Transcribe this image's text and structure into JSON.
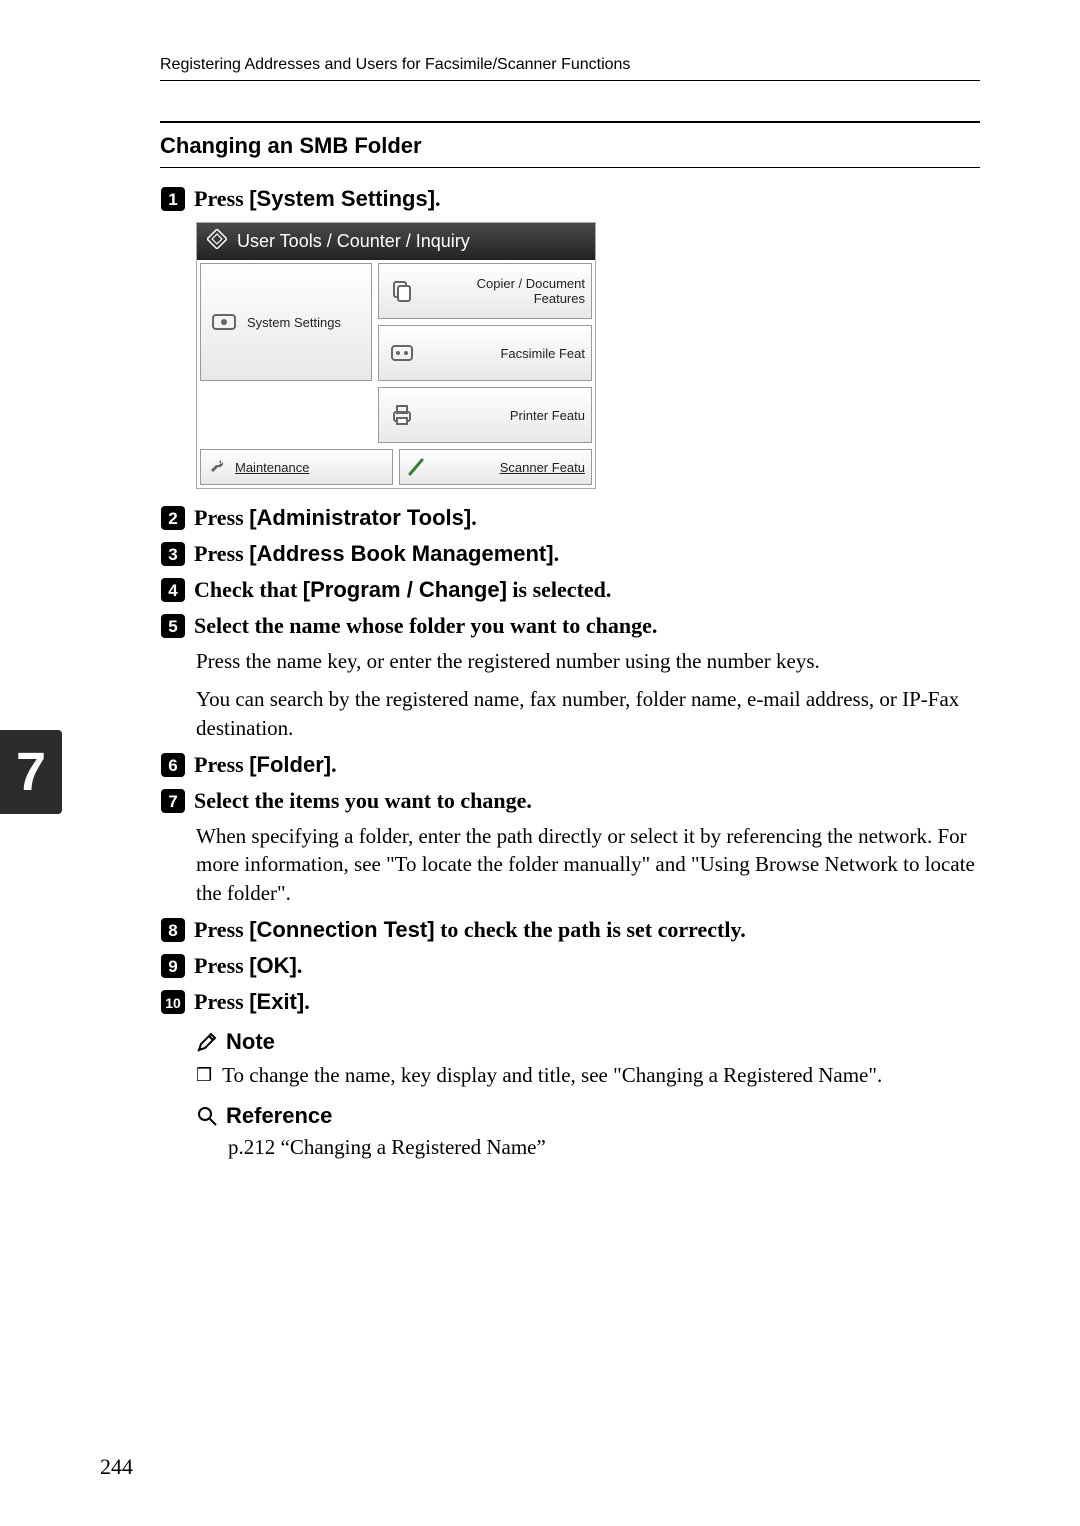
{
  "running_head": "Registering Addresses and Users for Facsimile/Scanner Functions",
  "section_heading": "Changing an SMB Folder",
  "side_tab": "7",
  "page_number": "244",
  "steps": [
    {
      "n": "1",
      "prefix": "Press ",
      "ui": "[System Settings]",
      "suffix": "."
    },
    {
      "n": "2",
      "prefix": "Press ",
      "ui": "[Administrator Tools]",
      "suffix": "."
    },
    {
      "n": "3",
      "prefix": "Press ",
      "ui": "[Address Book Management]",
      "suffix": "."
    },
    {
      "n": "4",
      "prefix": "Check that ",
      "ui": "[Program / Change]",
      "suffix": " is selected."
    },
    {
      "n": "5",
      "prefix": "Select the name whose folder you want to change.",
      "ui": "",
      "suffix": ""
    },
    {
      "n": "6",
      "prefix": "Press ",
      "ui": "[Folder]",
      "suffix": "."
    },
    {
      "n": "7",
      "prefix": "Select the items you want to change.",
      "ui": "",
      "suffix": ""
    },
    {
      "n": "8",
      "prefix": "Press ",
      "ui": "[Connection Test]",
      "suffix": " to check the path is set correctly."
    },
    {
      "n": "9",
      "prefix": "Press ",
      "ui": "[OK]",
      "suffix": "."
    },
    {
      "n": "10",
      "prefix": "Press ",
      "ui": "[Exit]",
      "suffix": "."
    }
  ],
  "step5_body": [
    "Press the name key, or enter the registered number using the number keys.",
    "You can search by the registered name, fax number, folder name, e-mail address, or IP-Fax destination."
  ],
  "step7_body": "When specifying a folder, enter the path directly or select it by referencing the network. For more information, see \"To locate the folder manually\" and \"Using Browse Network to locate the folder\".",
  "note": {
    "heading": "Note",
    "bullet": "To change the name, key display and title, see \"Changing a Registered Name\"."
  },
  "reference": {
    "heading": "Reference",
    "body": "p.212 “Changing a Registered Name”"
  },
  "ui_shot": {
    "title": "User Tools / Counter / Inquiry",
    "system_settings": "System Settings",
    "copier": "Copier / Document Features",
    "fax": "Facsimile Feat",
    "printer": "Printer Featu",
    "maintenance": "Maintenance",
    "scanner": "Scanner Featu"
  }
}
